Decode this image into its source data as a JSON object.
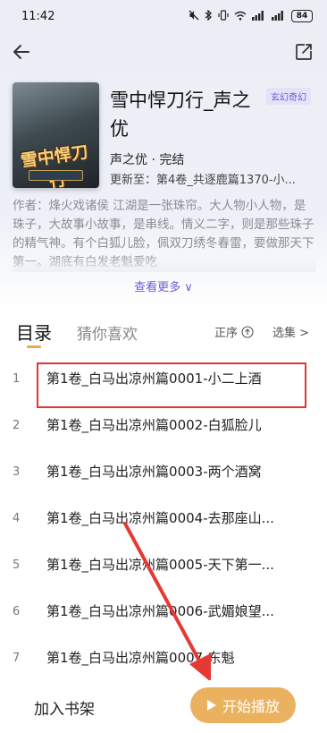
{
  "status_bar": {
    "time": "11:42",
    "battery": "84",
    "icons": [
      "mute-icon",
      "bluetooth-icon",
      "vibrate-icon",
      "wifi-icon",
      "signal-icon",
      "signal-icon"
    ]
  },
  "nav": {
    "back_icon": "arrow-left-icon",
    "share_icon": "share-icon"
  },
  "book": {
    "cover_text": "雪中悍刀行",
    "title": "雪中悍刀行_声之优",
    "genre": "玄幻奇幻",
    "author_status": "声之优 · 完结",
    "update_label": "更新至：第4卷_共逐鹿篇1370-小...",
    "description": "作者：烽火戏诸侯 江湖是一张珠帘。大人物小人物，是珠子，大故事小故事，是串线。情义二字，则是那些珠子的精气神。有个白狐儿脸，佩双刀绣冬春雷，要做那天下第一。湖底有白发老魁爱吃",
    "more_label": "查看更多 ∨"
  },
  "tabs": {
    "contents": "目录",
    "recommend": "猜你喜欢",
    "sort": "正序",
    "select": "选集 >"
  },
  "chapters": [
    {
      "num": "1",
      "title": "第1卷_白马出凉州篇0001-小二上酒"
    },
    {
      "num": "2",
      "title": "第1卷_白马出凉州篇0002-白狐脸儿"
    },
    {
      "num": "3",
      "title": "第1卷_白马出凉州篇0003-两个酒窝"
    },
    {
      "num": "4",
      "title": "第1卷_白马出凉州篇0004-去那座山..."
    },
    {
      "num": "5",
      "title": "第1卷_白马出凉州篇0005-天下第一..."
    },
    {
      "num": "6",
      "title": "第1卷_白马出凉州篇0006-武媚娘望..."
    },
    {
      "num": "7",
      "title": "第1卷_白马出凉州篇0007-东魁"
    }
  ],
  "bottom": {
    "shelf": "加入书架",
    "play": "开始播放"
  },
  "colors": {
    "accent": "#eab25f",
    "link": "#6a5fd6",
    "highlight": "#e0363a"
  }
}
